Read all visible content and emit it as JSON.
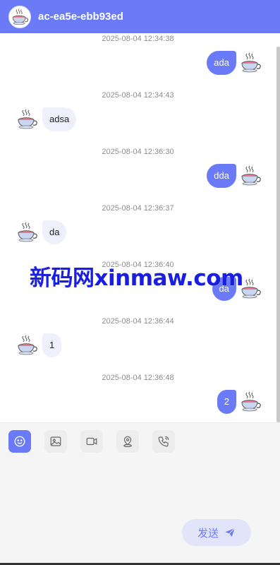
{
  "header": {
    "title": "ac-ea5e-ebb93ed",
    "avatar_icon": "teacup-icon"
  },
  "messages": [
    {
      "timestamp": "2025-08-04 12:34:38",
      "side": "right",
      "text": "ada"
    },
    {
      "timestamp": "2025-08-04 12:34:43",
      "side": "left",
      "text": "adsa"
    },
    {
      "timestamp": "2025-08-04 12:36:30",
      "side": "right",
      "text": "dda"
    },
    {
      "timestamp": "2025-08-04 12:36:37",
      "side": "left",
      "text": "da"
    },
    {
      "timestamp": "2025-08-04 12:36:40",
      "side": "right",
      "text": "da"
    },
    {
      "timestamp": "2025-08-04 12:36:44",
      "side": "left",
      "text": "1"
    },
    {
      "timestamp": "2025-08-04 12:36:48",
      "side": "right",
      "text": "2"
    }
  ],
  "watermark": "新码网xinmaw.com",
  "toolbar": {
    "tools": [
      {
        "name": "emoji-icon",
        "active": true
      },
      {
        "name": "image-icon",
        "active": false
      },
      {
        "name": "video-icon",
        "active": false
      },
      {
        "name": "location-icon",
        "active": false
      },
      {
        "name": "phone-icon",
        "active": false
      }
    ]
  },
  "composer": {
    "send_label": "发送"
  },
  "colors": {
    "accent": "#6b7bf7",
    "incoming_bubble": "#eef0fb",
    "composer_bg": "#f5f5f5",
    "send_bg": "#e2e5f9"
  }
}
